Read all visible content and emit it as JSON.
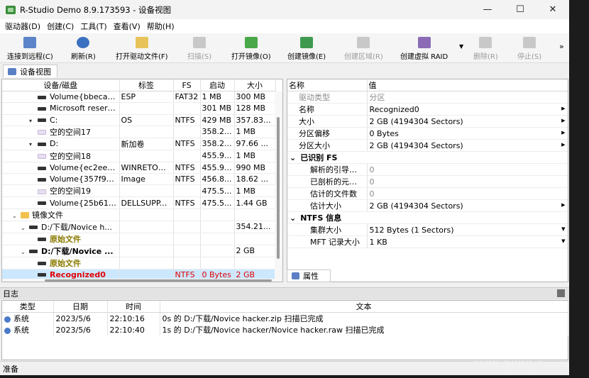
{
  "window": {
    "title": "R-Studio Demo 8.9.173593 - 设备视图",
    "minimize": "—",
    "maximize": "☐",
    "close": "✕"
  },
  "menu": [
    "驱动器(D)",
    "创建(C)",
    "工具(T)",
    "查看(V)",
    "帮助(H)"
  ],
  "toolbar": [
    {
      "label": "连接到远程(C)",
      "icon": "connect-remote-icon",
      "enabled": true
    },
    {
      "label": "刷新(R)",
      "icon": "refresh-icon",
      "enabled": true
    },
    {
      "label": "打开驱动文件(F)",
      "icon": "open-drive-file-icon",
      "enabled": true
    },
    {
      "label": "扫描(S)",
      "icon": "scan-icon",
      "enabled": false
    },
    {
      "label": "打开镜像(O)",
      "icon": "open-image-icon",
      "enabled": true
    },
    {
      "label": "创建镜像(E)",
      "icon": "create-image-icon",
      "enabled": true
    },
    {
      "label": "创建区域(R)",
      "icon": "create-region-icon",
      "enabled": false
    },
    {
      "label": "创建虚拟 RAID",
      "icon": "create-raid-icon",
      "enabled": true
    },
    {
      "label": "删除(R)",
      "icon": "delete-icon",
      "enabled": false
    },
    {
      "label": "停止(S)",
      "icon": "stop-icon",
      "enabled": false
    }
  ],
  "toolbar_more": "»",
  "toolbar_dropdown": "▼",
  "tab": "设备视图",
  "device_table": {
    "headers": [
      "设备/磁盘",
      "标签",
      "FS",
      "启动",
      "大小"
    ],
    "rows": [
      {
        "name": "Volume{bbecae...",
        "kind": "dev",
        "indent": 3,
        "arrow": "",
        "label": "ESP",
        "fs": "FAT32",
        "start": "1 MB",
        "size": "300 MB",
        "style": ""
      },
      {
        "name": "Microsoft reserv...",
        "kind": "dev",
        "indent": 3,
        "arrow": "",
        "label": "",
        "fs": "",
        "start": "301 MB",
        "size": "128 MB",
        "style": ""
      },
      {
        "name": "C:",
        "kind": "dev",
        "indent": 3,
        "arrow": "▾",
        "label": "OS",
        "fs": "NTFS",
        "start": "429 MB",
        "size": "357.83...",
        "style": ""
      },
      {
        "name": "空的空间17",
        "kind": "space",
        "indent": 3,
        "arrow": "",
        "label": "",
        "fs": "",
        "start": "358.2...",
        "size": "1 MB",
        "style": ""
      },
      {
        "name": "D:",
        "kind": "dev",
        "indent": 3,
        "arrow": "▾",
        "label": "新加卷",
        "fs": "NTFS",
        "start": "358.2...",
        "size": "97.66 ...",
        "style": ""
      },
      {
        "name": "空的空间18",
        "kind": "space",
        "indent": 3,
        "arrow": "",
        "label": "",
        "fs": "",
        "start": "455.9...",
        "size": "1 MB",
        "style": ""
      },
      {
        "name": "Volume{ec2eec5...",
        "kind": "dev",
        "indent": 3,
        "arrow": "",
        "label": "WINRETOO...",
        "fs": "NTFS",
        "start": "455.9...",
        "size": "990 MB",
        "style": ""
      },
      {
        "name": "Volume{357f976...",
        "kind": "dev",
        "indent": 3,
        "arrow": "",
        "label": "Image",
        "fs": "NTFS",
        "start": "456.8...",
        "size": "18.62 ...",
        "style": ""
      },
      {
        "name": "空的空间19",
        "kind": "space",
        "indent": 3,
        "arrow": "",
        "label": "",
        "fs": "",
        "start": "475.5...",
        "size": "1 MB",
        "style": ""
      },
      {
        "name": "Volume{25b61af...",
        "kind": "dev",
        "indent": 3,
        "arrow": "",
        "label": "DELLSUPP...",
        "fs": "NTFS",
        "start": "475.5...",
        "size": "1.44 GB",
        "style": ""
      },
      {
        "name": "镜像文件",
        "kind": "folder",
        "indent": 1,
        "arrow": "⌄",
        "label": "",
        "fs": "",
        "start": "",
        "size": "",
        "style": ""
      },
      {
        "name": "D:/下载/Novice h...",
        "kind": "dev",
        "indent": 2,
        "arrow": "⌄",
        "label": "",
        "fs": "",
        "start": "",
        "size": "354.21...",
        "style": ""
      },
      {
        "name": "原始文件",
        "kind": "dev",
        "indent": 4,
        "arrow": "",
        "label": "",
        "fs": "",
        "start": "",
        "size": "",
        "style": "olive"
      },
      {
        "name": "D:/下载/Novice ...",
        "kind": "dev",
        "indent": 2,
        "arrow": "⌄",
        "label": "",
        "fs": "",
        "start": "",
        "size": "2 GB",
        "style": "bold"
      },
      {
        "name": "原始文件",
        "kind": "dev",
        "indent": 4,
        "arrow": "",
        "label": "",
        "fs": "",
        "start": "",
        "size": "",
        "style": "olive"
      },
      {
        "name": "Recognized0",
        "kind": "dev",
        "indent": 4,
        "arrow": "",
        "label": "",
        "fs": "NTFS",
        "start": "0 Bytes",
        "size": "2 GB",
        "style": "red-selected"
      }
    ]
  },
  "properties": {
    "headers": [
      "名称",
      "值"
    ],
    "rows": [
      {
        "type": "item",
        "key": "驱动类型",
        "value": "分区",
        "gray_key": true,
        "gray_value": true,
        "arrow": false
      },
      {
        "type": "item",
        "key": "名称",
        "value": "Recognized0",
        "arrow": true
      },
      {
        "type": "item",
        "key": "大小",
        "value": "2 GB (4194304 Sectors)",
        "arrow": true
      },
      {
        "type": "item",
        "key": "分区偏移",
        "value": "0 Bytes",
        "arrow": true
      },
      {
        "type": "item",
        "key": "分区大小",
        "value": "2 GB (4194304 Sectors)",
        "arrow": true
      },
      {
        "type": "group",
        "key": "已识别 FS",
        "toggle": "⌄"
      },
      {
        "type": "sub",
        "key": "解析的引导记录",
        "value": "0",
        "gray_value": true,
        "arrow": false
      },
      {
        "type": "sub",
        "key": "已剖析的元文件",
        "value": "0",
        "gray_value": true,
        "arrow": false
      },
      {
        "type": "sub",
        "key": "估计的文件数",
        "value": "0",
        "gray_value": true,
        "arrow": false
      },
      {
        "type": "sub",
        "key": "估计大小",
        "value": "2 GB (4194304 Sectors)",
        "arrow": true
      },
      {
        "type": "group",
        "key": "NTFS 信息",
        "toggle": "⌄"
      },
      {
        "type": "sub",
        "key": "集群大小",
        "value": "512 Bytes (1 Sectors)",
        "arrow": true,
        "dropdown": true
      },
      {
        "type": "sub",
        "key": "MFT 记录大小",
        "value": "1 KB",
        "arrow": true,
        "dropdown": true
      }
    ]
  },
  "properties_tab": "属性",
  "log": {
    "title": "日志",
    "headers": [
      "类型",
      "日期",
      "时间",
      "文本"
    ],
    "rows": [
      {
        "type": "系统",
        "date": "2023/5/6",
        "time": "22:10:16",
        "text": "0s 的 D:/下载/Novice hacker.zip 扫描已完成"
      },
      {
        "type": "系统",
        "date": "2023/5/6",
        "time": "22:10:40",
        "text": "1s 的 D:/下载/Novice hacker/Novice hacker.raw 扫描已完成"
      }
    ]
  },
  "status": "准备",
  "watermark": "CSDN @DDD_Simple",
  "colors": {
    "selection": "#cce8ff",
    "red_text": "#e00000",
    "olive_text": "#8a7a00",
    "folder": "#f2c14e"
  }
}
